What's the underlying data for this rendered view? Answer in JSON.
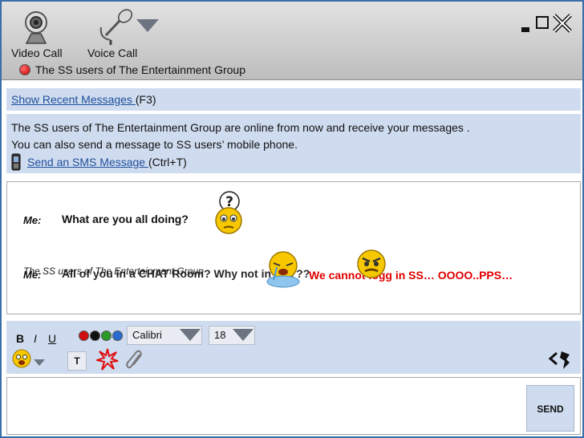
{
  "header": {
    "video_call_label": "Video Call",
    "voice_call_label": "Voice Call",
    "group_name": "The SS users of The Entertainment Group",
    "window_controls": [
      "minimize-icon",
      "maximize-icon",
      "close-icon"
    ]
  },
  "recent": {
    "link_label": "Show Recent Messages ",
    "shortcut": "(F3)"
  },
  "info": {
    "line1": "The SS users of The Entertainment Group are online from now and receive your messages .",
    "line2": "You can also send a message to SS users’ mobile phone.",
    "sms_link": "Send an SMS Message ",
    "sms_shortcut": "(Ctrl+T)"
  },
  "chat": {
    "messages": [
      {
        "sender": "Me:",
        "text": "What are you all doing?",
        "icon": "question-smiley-icon"
      },
      {
        "sender": "Me:",
        "text": "All of you in a CHAT Room?  Why not in SS???",
        "icon": "crying-smiley-icon"
      }
    ],
    "overlay_sender": "The SS users of The Entertainment Group",
    "reply_text": "We cannot logg in SS… OOOO..PPS…",
    "reply_color": "#e00000"
  },
  "toolbar": {
    "bold": "B",
    "italic": "I",
    "underline": "U",
    "font": "Calibri",
    "size": "18",
    "text_button": "T",
    "color_dots": [
      "#d01010",
      "#111111",
      "#2a9a2a",
      "#2a6ad0"
    ]
  },
  "send_label": "SEND"
}
